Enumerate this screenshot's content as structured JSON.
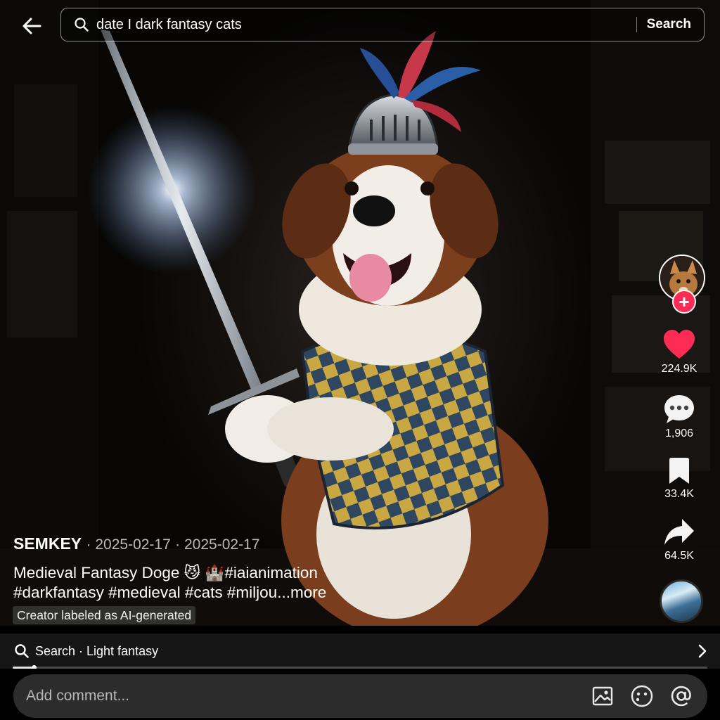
{
  "search": {
    "query": "date I dark fantasy cats",
    "button_label": "Search"
  },
  "post": {
    "author": "SEMKEY",
    "date_1": "2025-02-17",
    "date_2": "2025-02-17",
    "caption": "Medieval Fantasy Doge 😼 🏰#iaianimation #darkfantasy #medieval #cats #miljou",
    "more_label": "...more",
    "ai_label": "Creator labeled as AI-generated"
  },
  "actions": {
    "follow_symbol": "+",
    "likes": "224.9K",
    "comments": "1,906",
    "saves": "33.4K",
    "shares": "64.5K"
  },
  "suggestion": {
    "label": "Search · Light fantasy"
  },
  "playback": {
    "progress_fraction": 0.03
  },
  "comment_bar": {
    "placeholder": "Add comment..."
  },
  "icons": {
    "back": "arrow-left-icon",
    "search": "magnifier-icon",
    "like": "heart-icon",
    "comment": "chat-bubble-icon",
    "save": "bookmark-icon",
    "share": "share-arrow-icon",
    "image": "image-icon",
    "emoji": "emoji-icon",
    "mention": "at-sign-icon",
    "chevron": "chevron-right-icon"
  },
  "colors": {
    "like_red": "#fe2c55",
    "follow_red": "#fe2c55"
  }
}
